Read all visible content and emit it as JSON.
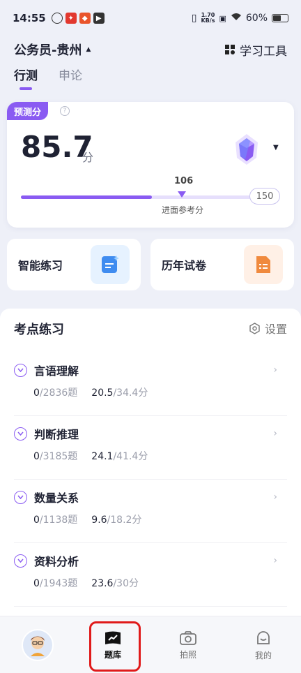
{
  "status": {
    "time": "14:55",
    "net_top": "1.70",
    "net_bottom": "KB/s",
    "battery": "60%",
    "battery_level": 0.6
  },
  "header": {
    "exam": "公务员-贵州",
    "tool": "学习工具"
  },
  "tabs": [
    "行测",
    "申论"
  ],
  "prediction": {
    "badge": "预测分",
    "score": "85.7",
    "unit": "分",
    "reference": "106",
    "reference_label": "进面参考分",
    "max": "150",
    "progress": 0.571
  },
  "cards": {
    "smart": "智能练习",
    "past": "历年试卷"
  },
  "section": {
    "title": "考点练习",
    "settings": "设置"
  },
  "topics": [
    {
      "name": "言语理解",
      "done": "0",
      "total": "/2836题",
      "score": "20.5",
      "max": "/34.4分"
    },
    {
      "name": "判断推理",
      "done": "0",
      "total": "/3185题",
      "score": "24.1",
      "max": "/41.4分"
    },
    {
      "name": "数量关系",
      "done": "0",
      "total": "/1138题",
      "score": "9.6",
      "max": "/18.2分"
    },
    {
      "name": "资料分析",
      "done": "0",
      "total": "/1943题",
      "score": "23.6",
      "max": "/30分"
    }
  ],
  "nav": {
    "bank": "题库",
    "photo": "拍照",
    "mine": "我的"
  },
  "colors": {
    "accent": "#8a5bf2",
    "highlight": "#e01a1a"
  }
}
